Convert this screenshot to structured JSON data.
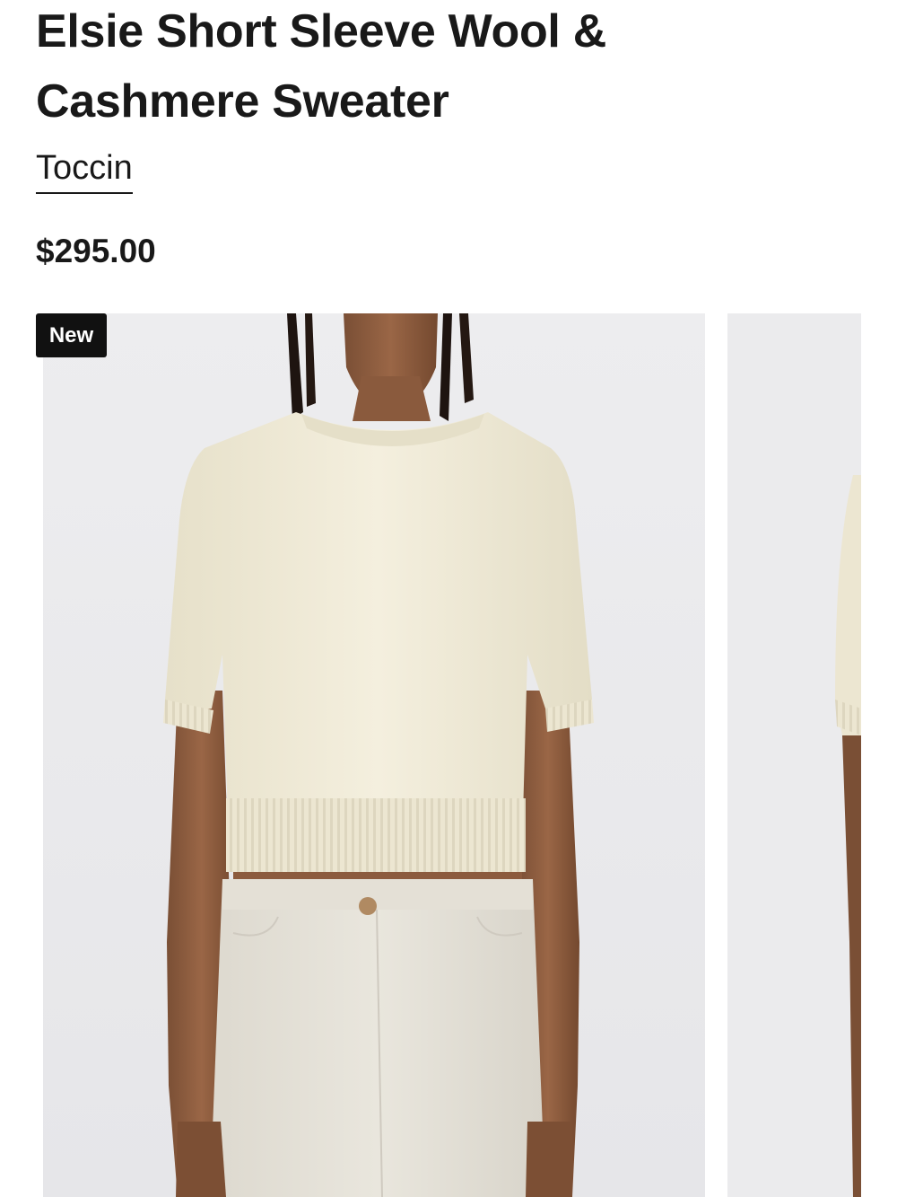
{
  "product": {
    "title": "Elsie Short Sleeve Wool & Cashmere Sweater",
    "brand": "Toccin",
    "price": "$295.00"
  },
  "gallery": {
    "badge": "New",
    "images": [
      {
        "alt": "Model wearing cream short sleeve knit sweater with light pants, front view",
        "visible": "full"
      },
      {
        "alt": "Model wearing cream short sleeve knit sweater, alternate view",
        "visible": "partial"
      }
    ]
  },
  "colors": {
    "text": "#191919",
    "badge_bg": "#111111",
    "badge_text": "#ffffff",
    "photo_bg": "#ebebed",
    "sweater": "#f1ecd9"
  }
}
